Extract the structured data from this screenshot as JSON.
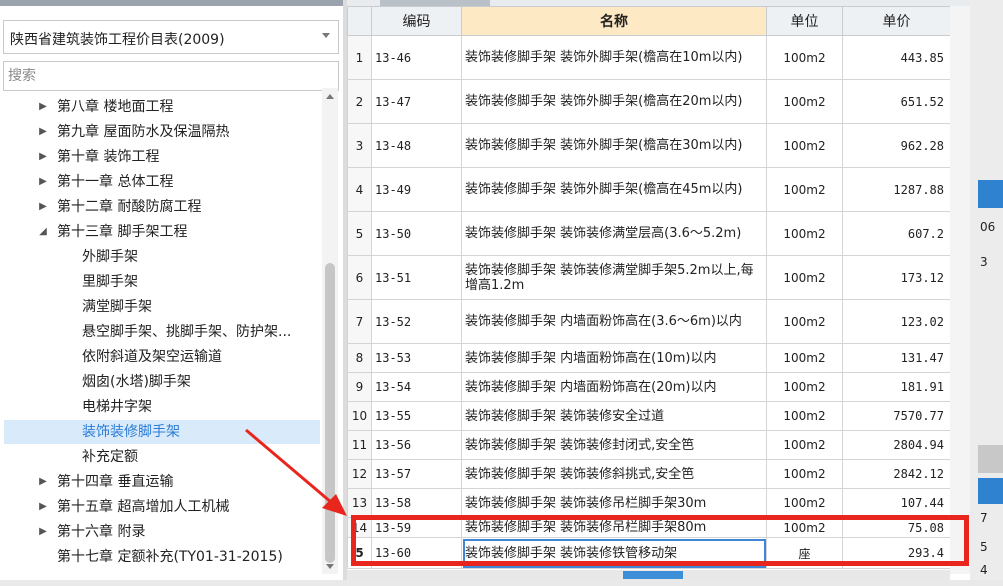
{
  "library": {
    "selected": "陕西省建筑装饰工程价目表(2009)"
  },
  "search": {
    "placeholder": "搜索"
  },
  "tree": {
    "items": [
      {
        "label": "第八章 楼地面工程",
        "expand": "collapsed"
      },
      {
        "label": "第九章 屋面防水及保温隔热",
        "expand": "collapsed"
      },
      {
        "label": "第十章 装饰工程",
        "expand": "collapsed"
      },
      {
        "label": "第十一章 总体工程",
        "expand": "collapsed"
      },
      {
        "label": "第十二章 耐酸防腐工程",
        "expand": "collapsed"
      },
      {
        "label": "第十三章 脚手架工程",
        "expand": "expanded"
      },
      {
        "label": "外脚手架",
        "expand": "none"
      },
      {
        "label": "里脚手架",
        "expand": "none"
      },
      {
        "label": "满堂脚手架",
        "expand": "none"
      },
      {
        "label": "悬空脚手架、挑脚手架、防护架...",
        "expand": "none"
      },
      {
        "label": "依附斜道及架空运输道",
        "expand": "none"
      },
      {
        "label": "烟囱(水塔)脚手架",
        "expand": "none"
      },
      {
        "label": "电梯井字架",
        "expand": "none"
      },
      {
        "label": "装饰装修脚手架",
        "expand": "none",
        "selected": true
      },
      {
        "label": "补充定额",
        "expand": "none"
      },
      {
        "label": "第十四章 垂直运输",
        "expand": "collapsed"
      },
      {
        "label": "第十五章 超高增加人工机械",
        "expand": "collapsed"
      },
      {
        "label": "第十六章 附录",
        "expand": "collapsed"
      },
      {
        "label": "第十七章 定额补充(TY01-31-2015)",
        "expand": "none"
      }
    ]
  },
  "grid": {
    "headers": {
      "idx": "",
      "code": "编码",
      "name": "名称",
      "unit": "单位",
      "price": "单价"
    },
    "rows": [
      {
        "idx": "1",
        "code": "13-46",
        "name": "装饰装修脚手架 装饰外脚手架(檐高在10m以内)",
        "unit": "100m2",
        "price": "443.85"
      },
      {
        "idx": "2",
        "code": "13-47",
        "name": "装饰装修脚手架 装饰外脚手架(檐高在20m以内)",
        "unit": "100m2",
        "price": "651.52"
      },
      {
        "idx": "3",
        "code": "13-48",
        "name": "装饰装修脚手架 装饰外脚手架(檐高在30m以内)",
        "unit": "100m2",
        "price": "962.28"
      },
      {
        "idx": "4",
        "code": "13-49",
        "name": "装饰装修脚手架 装饰外脚手架(檐高在45m以内)",
        "unit": "100m2",
        "price": "1287.88"
      },
      {
        "idx": "5",
        "code": "13-50",
        "name": "装饰装修脚手架 装饰装修满堂层高(3.6～5.2m)",
        "unit": "100m2",
        "price": "607.2"
      },
      {
        "idx": "6",
        "code": "13-51",
        "name": "装饰装修脚手架 装饰装修满堂脚手架5.2m以上,每增高1.2m",
        "unit": "100m2",
        "price": "173.12"
      },
      {
        "idx": "7",
        "code": "13-52",
        "name": "装饰装修脚手架 内墙面粉饰高在(3.6～6m)以内",
        "unit": "100m2",
        "price": "123.02"
      },
      {
        "idx": "8",
        "code": "13-53",
        "name": "装饰装修脚手架 内墙面粉饰高在(10m)以内",
        "unit": "100m2",
        "price": "131.47"
      },
      {
        "idx": "9",
        "code": "13-54",
        "name": "装饰装修脚手架 内墙面粉饰高在(20m)以内",
        "unit": "100m2",
        "price": "181.91"
      },
      {
        "idx": "10",
        "code": "13-55",
        "name": "装饰装修脚手架 装饰装修安全过道",
        "unit": "100m2",
        "price": "7570.77"
      },
      {
        "idx": "11",
        "code": "13-56",
        "name": "装饰装修脚手架 装饰装修封闭式,安全笆",
        "unit": "100m2",
        "price": "2804.94"
      },
      {
        "idx": "12",
        "code": "13-57",
        "name": "装饰装修脚手架 装饰装修斜挑式,安全笆",
        "unit": "100m2",
        "price": "2842.12"
      },
      {
        "idx": "13",
        "code": "13-58",
        "name": "装饰装修脚手架 装饰装修吊栏脚手架30m",
        "unit": "100m2",
        "price": "107.44"
      },
      {
        "idx": "14",
        "code": "13-59",
        "name": "装饰装修脚手架 装饰装修吊栏脚手架80m",
        "unit": "100m2",
        "price": "75.08"
      },
      {
        "idx": "5",
        "code": "13-60",
        "name": "装饰装修脚手架 装饰装修铁管移动架",
        "unit": "座",
        "price": "293.4"
      }
    ]
  },
  "right_edge": {
    "t1": "06",
    "t2": "3",
    "t3": "7",
    "t4": "5",
    "t5": "4"
  },
  "colors": {
    "annotation_red": "#e8261d",
    "accent_blue": "#2f82cf",
    "header_highlight": "#fde9c4"
  }
}
